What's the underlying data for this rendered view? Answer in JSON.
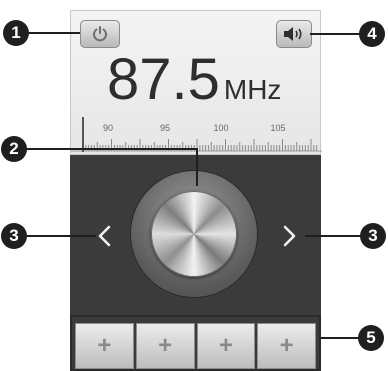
{
  "radio": {
    "frequency": "87.5",
    "unit": "MHz",
    "scale_labels": [
      "90",
      "95",
      "100",
      "105"
    ]
  },
  "buttons": {
    "power_icon": "power-icon",
    "volume_icon": "speaker-icon",
    "prev_icon": "chevron-left-icon",
    "next_icon": "chevron-right-icon"
  },
  "presets": [
    "+",
    "+",
    "+",
    "+"
  ],
  "callouts": {
    "power": "1",
    "dial": "2",
    "left": "3",
    "right": "3",
    "volume": "4",
    "presets": "5"
  },
  "colors": {
    "panel_dark": "#3b3b3b",
    "needle": "#555555",
    "callout": "#1f1f1f"
  }
}
